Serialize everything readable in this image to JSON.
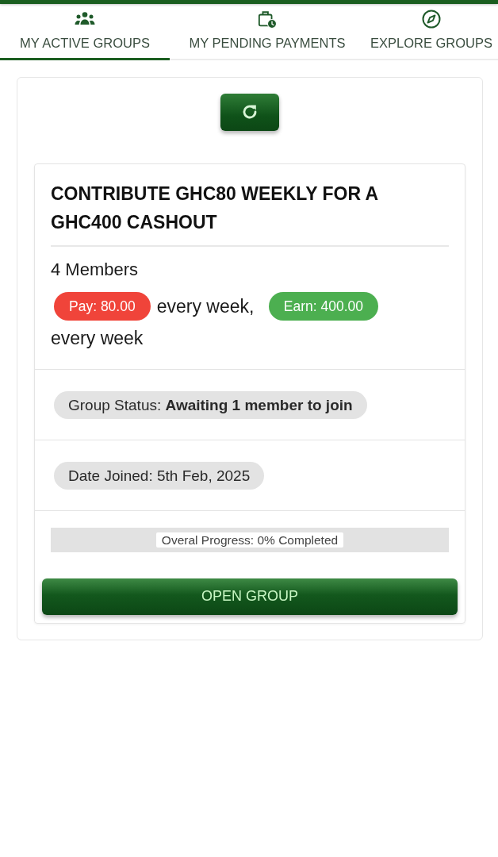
{
  "tabs": [
    {
      "label": "MY ACTIVE GROUPS",
      "selected": true
    },
    {
      "label": "MY PENDING PAYMENTS",
      "selected": false
    },
    {
      "label": "EXPLORE GROUPS",
      "selected": false
    }
  ],
  "group_card": {
    "title": "CONTRIBUTE GHC80 WEEKLY FOR A GHC400 CASHOUT",
    "members": "4 Members",
    "pay_badge": "Pay: 80.00",
    "pay_frequency": "every week,",
    "earn_badge": "Earn: 400.00",
    "earn_frequency": "every week",
    "status": "Group Status: **Awaiting 1 member to join**",
    "date_joined": "Date Joined: 5th Feb, 2025",
    "progress": {
      "label": "Overal Progress: 0% Completed",
      "level": 0
    },
    "open_button": "OPEN GROUP"
  }
}
